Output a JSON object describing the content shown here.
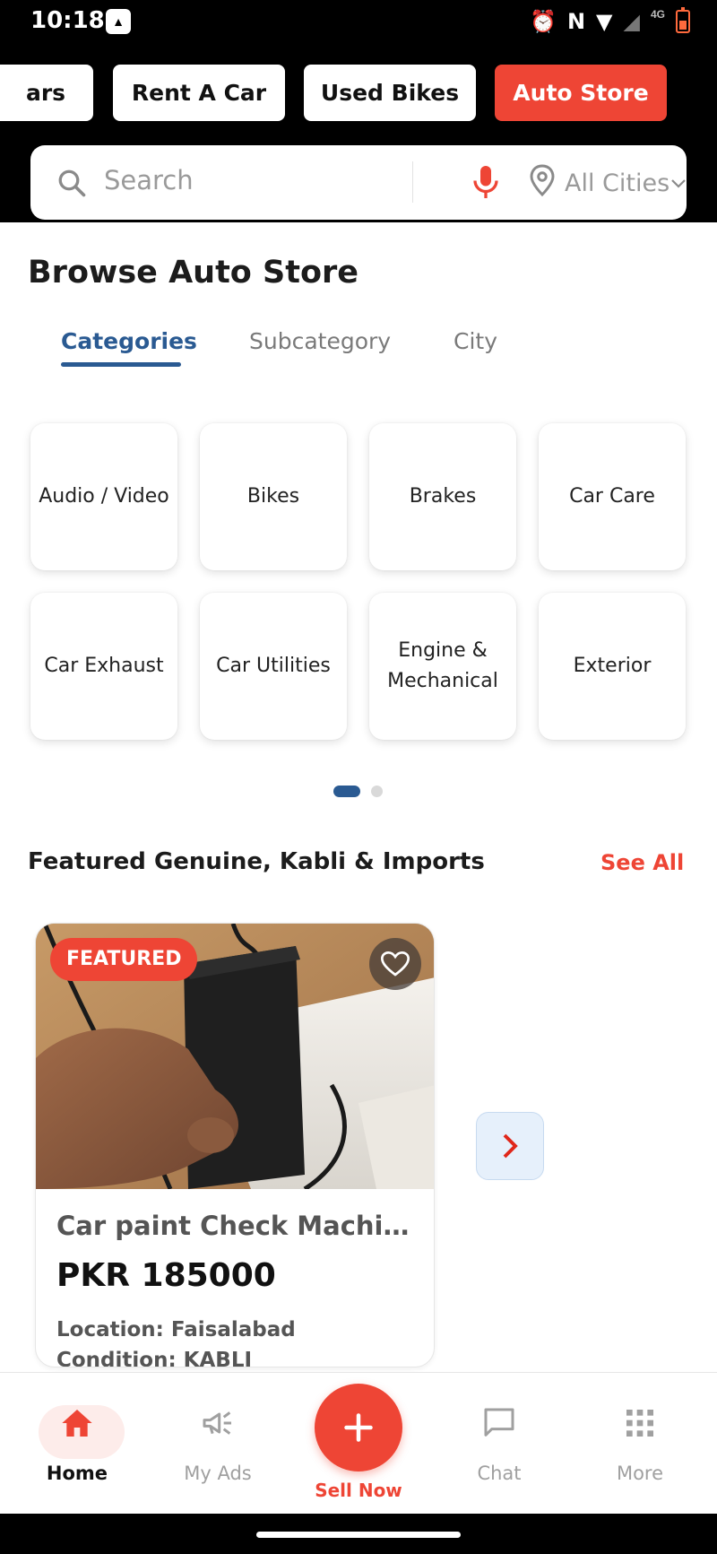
{
  "status_bar": {
    "time": "10:18",
    "network_label": "4G"
  },
  "header": {
    "chips": [
      {
        "label": "ars",
        "active": false
      },
      {
        "label": "Rent A Car",
        "active": false
      },
      {
        "label": "Used Bikes",
        "active": false
      },
      {
        "label": "Auto Store",
        "active": true
      }
    ],
    "search": {
      "placeholder": "Search",
      "city_value": "All Cities"
    }
  },
  "browse": {
    "title": "Browse Auto Store",
    "tabs": [
      "Categories",
      "Subcategory",
      "City"
    ],
    "active_tab": "Categories",
    "categories": [
      "Audio / Video",
      "Bikes",
      "Brakes",
      "Car Care",
      "Car Exhaust",
      "Car Utilities",
      "Engine & Mechanical",
      "Exterior"
    ],
    "pager": {
      "current_page": 1,
      "total_pages": 2
    }
  },
  "featured": {
    "title": "Featured Genuine, Kabli & Imports",
    "see_all_label": "See All",
    "items": [
      {
        "badge": "FEATURED",
        "name": "Car paint Check Machine n…",
        "price": "PKR 185000",
        "location": "Location: Faisalabad",
        "condition": "Condition: KABLI"
      }
    ]
  },
  "bottom_nav": {
    "items": [
      {
        "label": "Home",
        "icon": "home-icon",
        "active": true
      },
      {
        "label": "My Ads",
        "icon": "megaphone-icon",
        "active": false
      },
      {
        "label": "Sell Now",
        "icon": "plus-icon",
        "active": false
      },
      {
        "label": "Chat",
        "icon": "chat-icon",
        "active": false
      },
      {
        "label": "More",
        "icon": "grid-icon",
        "active": false
      }
    ]
  },
  "colors": {
    "accent_red": "#ee4535",
    "brand_blue": "#2a5a92",
    "header_black": "#000000"
  }
}
